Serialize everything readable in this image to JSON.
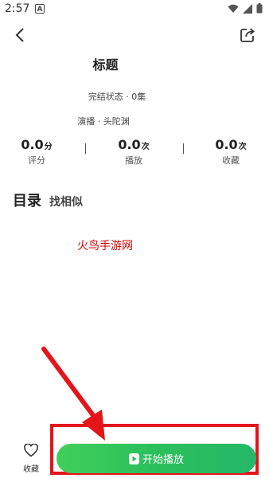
{
  "status_bar": {
    "time": "2:57",
    "notice": "A"
  },
  "title": "标题",
  "meta": {
    "status": "完结状态 · 0集",
    "cast": "演播 · 头陀渊"
  },
  "stats": [
    {
      "value": "0.0",
      "unit": "分",
      "label": "评分"
    },
    {
      "value": "0.0",
      "unit": "次",
      "label": "播放"
    },
    {
      "value": "0.0",
      "unit": "次",
      "label": "收藏"
    }
  ],
  "section": {
    "title": "目录",
    "subtitle": "找相似"
  },
  "watermark": "火鸟手游网",
  "bottom_bar": {
    "favorite_label": "收藏",
    "play_label": "开始播放"
  },
  "colors": {
    "accent_green": "#2bbf5c",
    "annotation_red": "#e3151b"
  },
  "icons": [
    "back-arrow-icon",
    "share-icon",
    "heart-icon",
    "play-icon",
    "wifi-icon",
    "signal-icon",
    "battery-icon"
  ]
}
